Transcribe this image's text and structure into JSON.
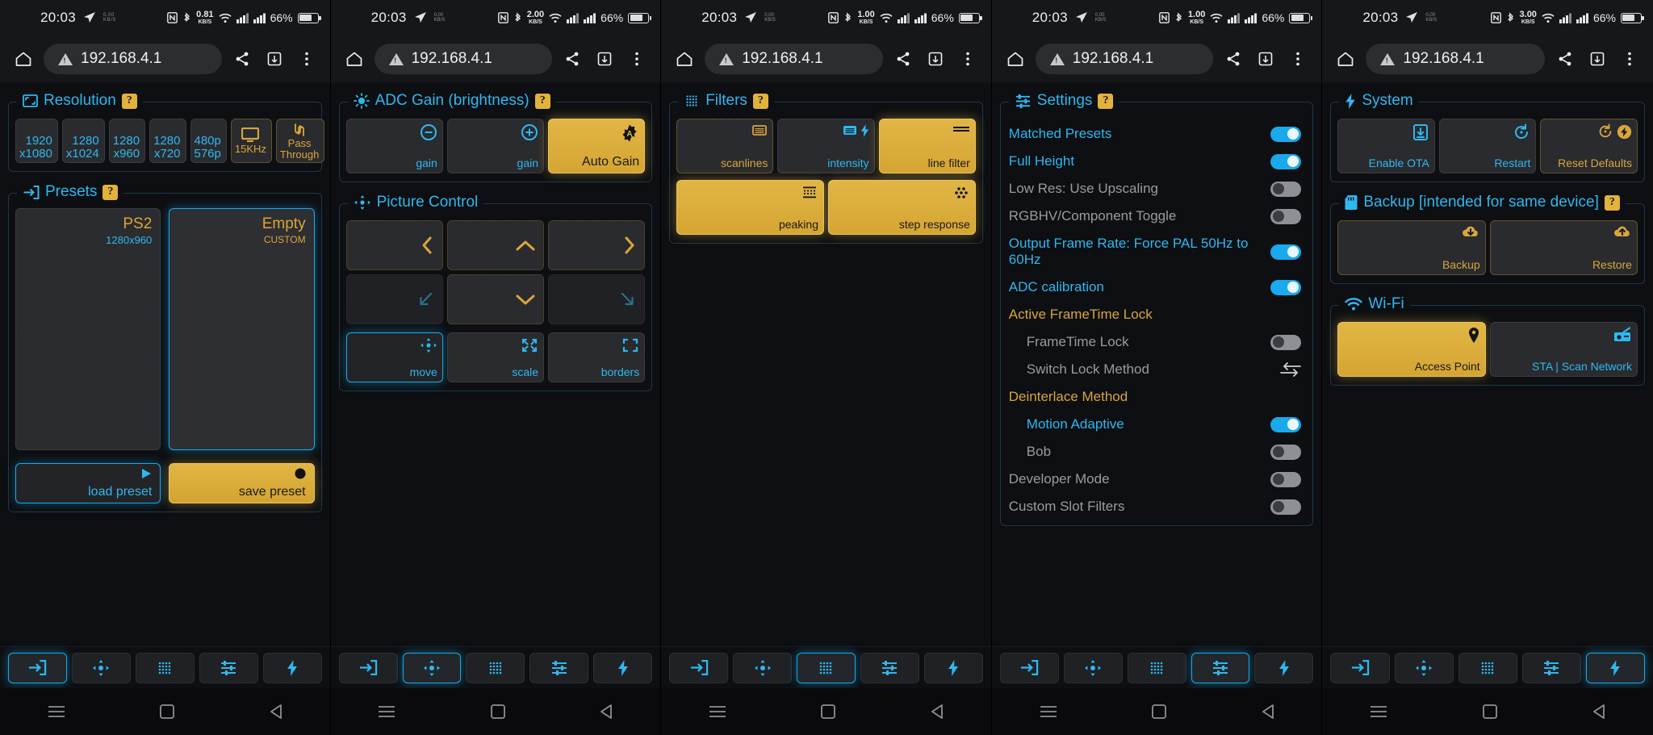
{
  "status_bar": {
    "time": "20:03",
    "nfc_icon": "nfc-icon",
    "bluetooth_icon": "bluetooth-icon",
    "net_rates": [
      "0.81",
      "2.00",
      "1.00",
      "1.00",
      "3.00"
    ],
    "net_unit": "KB/S",
    "wifi_icon": "wifi-icon",
    "battery_pct": "66%"
  },
  "browser": {
    "home_icon": "home-icon",
    "url": "192.168.4.1",
    "security_icon": "warning-triangle-icon",
    "share_icon": "share-icon",
    "tabs_icon": "tab-switcher-icon",
    "menu_icon": "more-vertical-icon"
  },
  "panel1": {
    "resolution": {
      "title": "Resolution",
      "icon": "resize-icon",
      "help": "?",
      "buttons": [
        {
          "line1": "1920",
          "line2": "x1080",
          "state": "normal"
        },
        {
          "line1": "1280",
          "line2": "x1024",
          "state": "normal"
        },
        {
          "line1": "1280",
          "line2": "x960",
          "state": "normal"
        },
        {
          "line1": "1280",
          "line2": "x720",
          "state": "normal"
        },
        {
          "line1": "480p",
          "line2": "576p",
          "state": "normal"
        }
      ],
      "extra": [
        {
          "label": "15KHz",
          "icon": "monitor-icon",
          "state": "amber"
        },
        {
          "label_line1": "Pass",
          "label_line2": "Through",
          "icon": "passthrough-icon",
          "state": "amber"
        }
      ]
    },
    "presets": {
      "title": "Presets",
      "icon": "login-arrow-icon",
      "help": "?",
      "slots": [
        {
          "name": "PS2",
          "sub": "1280x960",
          "selected": false
        },
        {
          "name": "Empty",
          "sub": "CUSTOM",
          "selected": true
        }
      ],
      "actions": [
        {
          "label": "load preset",
          "icon": "play-triangle-icon",
          "style": "blue"
        },
        {
          "label": "save preset",
          "icon": "record-dot-icon",
          "style": "amber"
        }
      ]
    }
  },
  "panel2": {
    "adc_gain": {
      "title": "ADC Gain (brightness)",
      "icon": "brightness-icon",
      "help": "?",
      "buttons": [
        {
          "label": "gain",
          "icon": "minus-circle-icon",
          "state": "normal"
        },
        {
          "label": "gain",
          "icon": "plus-circle-icon",
          "state": "normal"
        },
        {
          "label": "Auto Gain",
          "icon": "auto-badge-icon",
          "state": "selected"
        }
      ]
    },
    "picture_control": {
      "title": "Picture Control",
      "icon": "move-arrows-icon",
      "pad": [
        {
          "icon": "chevron-left-icon",
          "state": "amber"
        },
        {
          "icon": "chevron-up-icon",
          "state": "amber"
        },
        {
          "icon": "chevron-right-icon",
          "state": "amber"
        },
        {
          "icon": "arrow-down-left-icon",
          "state": "plain"
        },
        {
          "icon": "chevron-down-icon",
          "state": "amber"
        },
        {
          "icon": "arrow-down-right-icon",
          "state": "plain"
        }
      ],
      "modes": [
        {
          "label": "move",
          "icon": "move-arrows-icon",
          "state": "selected-blue"
        },
        {
          "label": "scale",
          "icon": "expand-icon",
          "state": "normal"
        },
        {
          "label": "borders",
          "icon": "crop-frame-icon",
          "state": "normal"
        }
      ]
    }
  },
  "panel3": {
    "filters": {
      "title": "Filters",
      "icon": "dot-grid-icon",
      "help": "?",
      "row1": [
        {
          "label": "scanlines",
          "icon": "scanlines-icon",
          "state": "amber"
        },
        {
          "label": "intensity",
          "icon": "intensity-icon",
          "state": "blue"
        },
        {
          "label": "line filter",
          "icon": "lines-icon",
          "state": "selected"
        }
      ],
      "row2": [
        {
          "label": "peaking",
          "icon": "peaking-icon",
          "state": "selected"
        },
        {
          "label": "step response",
          "icon": "step-response-icon",
          "state": "selected"
        }
      ]
    }
  },
  "panel4": {
    "settings": {
      "title": "Settings",
      "icon": "sliders-icon",
      "help": "?",
      "rows": [
        {
          "label": "Matched Presets",
          "type": "toggle",
          "value": true,
          "style": "on",
          "indent": false
        },
        {
          "label": "Full Height",
          "type": "toggle",
          "value": true,
          "style": "on",
          "indent": false
        },
        {
          "label": "Low Res: Use Upscaling",
          "type": "toggle",
          "value": false,
          "style": "off",
          "indent": false
        },
        {
          "label": "RGBHV/Component Toggle",
          "type": "toggle",
          "value": false,
          "style": "off",
          "indent": false
        },
        {
          "label": "Output Frame Rate: Force PAL 50Hz to 60Hz",
          "type": "toggle",
          "value": true,
          "style": "on",
          "indent": false
        },
        {
          "label": "ADC calibration",
          "type": "toggle",
          "value": true,
          "style": "on",
          "indent": false
        },
        {
          "label": "Active FrameTime Lock",
          "type": "header",
          "value": null,
          "style": "header",
          "indent": false
        },
        {
          "label": "FrameTime Lock",
          "type": "toggle",
          "value": false,
          "style": "off",
          "indent": true
        },
        {
          "label": "Switch Lock Method",
          "type": "swap",
          "value": null,
          "style": "off",
          "indent": true
        },
        {
          "label": "Deinterlace Method",
          "type": "header",
          "value": null,
          "style": "header",
          "indent": false
        },
        {
          "label": "Motion Adaptive",
          "type": "toggle",
          "value": true,
          "style": "on",
          "indent": true
        },
        {
          "label": "Bob",
          "type": "toggle",
          "value": false,
          "style": "off",
          "indent": true
        },
        {
          "label": "Developer Mode",
          "type": "toggle",
          "value": false,
          "style": "off",
          "indent": false
        },
        {
          "label": "Custom Slot Filters",
          "type": "toggle",
          "value": false,
          "style": "off",
          "indent": false
        }
      ]
    }
  },
  "panel5": {
    "system": {
      "title": "System",
      "icon": "bolt-icon",
      "buttons": [
        {
          "label": "Enable OTA",
          "icon": "download-box-icon",
          "state": "blue"
        },
        {
          "label": "Restart",
          "icon": "restart-icon",
          "state": "blue"
        },
        {
          "label": "Reset Defaults",
          "icon": "reset-bolt-icon",
          "state": "amber"
        }
      ]
    },
    "backup": {
      "title": "Backup [intended for same device]",
      "icon": "sdcard-icon",
      "help": "?",
      "buttons": [
        {
          "label": "Backup",
          "icon": "cloud-download-icon",
          "state": "amber"
        },
        {
          "label": "Restore",
          "icon": "cloud-upload-icon",
          "state": "amber"
        }
      ]
    },
    "wifi": {
      "title": "Wi-Fi",
      "icon": "wifi-icon",
      "buttons": [
        {
          "label": "Access Point",
          "icon": "map-pin-icon",
          "state": "selected"
        },
        {
          "label": "STA | Scan Network",
          "icon": "radio-icon",
          "state": "blue"
        }
      ]
    }
  },
  "bottom_nav": {
    "items": [
      {
        "name": "tab-presets",
        "icon": "login-arrow-icon"
      },
      {
        "name": "tab-picture",
        "icon": "move-arrows-icon"
      },
      {
        "name": "tab-filters",
        "icon": "dot-grid-icon"
      },
      {
        "name": "tab-settings",
        "icon": "sliders-icon"
      },
      {
        "name": "tab-system",
        "icon": "bolt-icon"
      }
    ],
    "selected_per_screen": [
      0,
      1,
      2,
      3,
      4
    ]
  },
  "android_nav": {
    "menu_icon": "hamburger-icon",
    "home_icon": "square-icon",
    "back_icon": "back-triangle-icon"
  },
  "colors": {
    "accent_blue": "#2eb8f0",
    "accent_amber": "#d9a63a",
    "selected_amber_bg": "#e1b645",
    "background": "#0d0f12"
  }
}
